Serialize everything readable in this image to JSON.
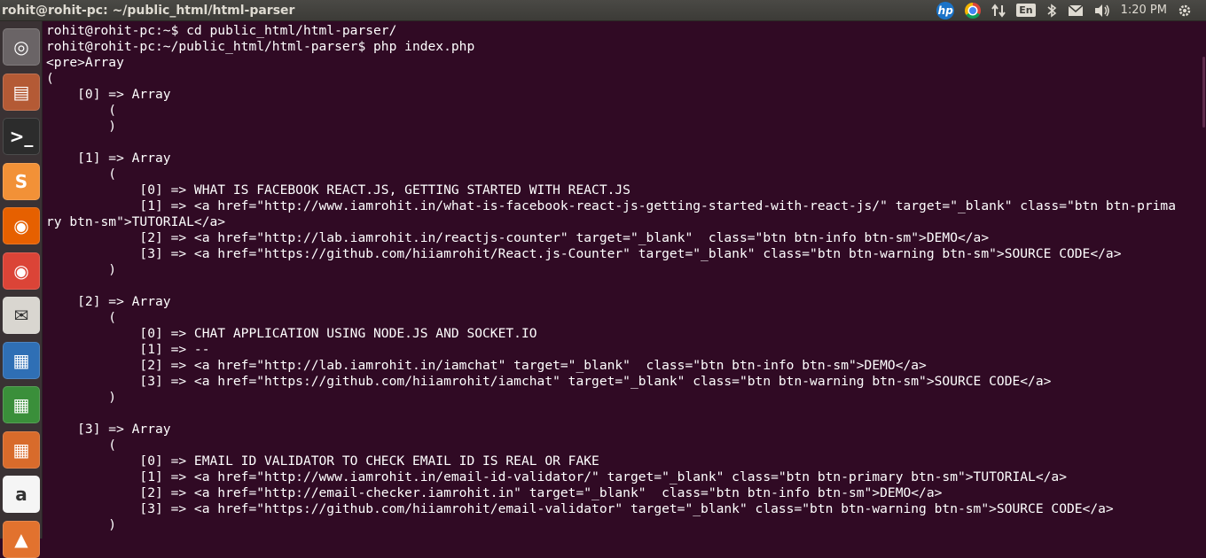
{
  "window": {
    "title": "rohit@rohit-pc: ~/public_html/html-parser"
  },
  "indicators": {
    "hp_label": "hp",
    "lang": "En",
    "clock": "1:20 PM",
    "icons": [
      "hp-icon",
      "chrome-icon",
      "network-arrows-icon",
      "keyboard-lang-icon",
      "bluetooth-icon",
      "mail-icon",
      "volume-icon"
    ]
  },
  "launcher": {
    "items": [
      {
        "name": "ubuntu-dash-icon",
        "glyph": "◎",
        "bg": "#6a6466"
      },
      {
        "name": "files-icon",
        "glyph": "▤",
        "bg": "#b45a35"
      },
      {
        "name": "terminal-icon",
        "glyph": ">_",
        "bg": "#2c2c2c"
      },
      {
        "name": "sublime-text-icon",
        "glyph": "S",
        "bg": "#f29137"
      },
      {
        "name": "firefox-icon",
        "glyph": "◉",
        "bg": "#e66000"
      },
      {
        "name": "chrome-icon",
        "glyph": "◉",
        "bg": "#db4437"
      },
      {
        "name": "mail-client-icon",
        "glyph": "✉",
        "bg": "#d9d6d0"
      },
      {
        "name": "writer-icon",
        "glyph": "▦",
        "bg": "#2f6fb5"
      },
      {
        "name": "calc-icon",
        "glyph": "▦",
        "bg": "#3a8f3a"
      },
      {
        "name": "impress-icon",
        "glyph": "▦",
        "bg": "#d86b2b"
      },
      {
        "name": "amazon-icon",
        "glyph": "a",
        "bg": "#f5f5f5"
      },
      {
        "name": "software-center-icon",
        "glyph": "▲",
        "bg": "#e2722e"
      }
    ]
  },
  "terminal": {
    "lines": [
      "rohit@rohit-pc:~$ cd public_html/html-parser/",
      "rohit@rohit-pc:~/public_html/html-parser$ php index.php",
      "<pre>Array",
      "(",
      "    [0] => Array",
      "        (",
      "        )",
      "",
      "    [1] => Array",
      "        (",
      "            [0] => WHAT IS FACEBOOK REACT.JS, GETTING STARTED WITH REACT.JS",
      "            [1] => <a href=\"http://www.iamrohit.in/what-is-facebook-react-js-getting-started-with-react-js/\" target=\"_blank\" class=\"btn btn-prima",
      "ry btn-sm\">TUTORIAL</a>",
      "            [2] => <a href=\"http://lab.iamrohit.in/reactjs-counter\" target=\"_blank\"  class=\"btn btn-info btn-sm\">DEMO</a>",
      "            [3] => <a href=\"https://github.com/hiiamrohit/React.js-Counter\" target=\"_blank\" class=\"btn btn-warning btn-sm\">SOURCE CODE</a>",
      "        )",
      "",
      "    [2] => Array",
      "        (",
      "            [0] => CHAT APPLICATION USING NODE.JS AND SOCKET.IO",
      "            [1] => --",
      "            [2] => <a href=\"http://lab.iamrohit.in/iamchat\" target=\"_blank\"  class=\"btn btn-info btn-sm\">DEMO</a>",
      "            [3] => <a href=\"https://github.com/hiiamrohit/iamchat\" target=\"_blank\" class=\"btn btn-warning btn-sm\">SOURCE CODE</a>",
      "        )",
      "",
      "    [3] => Array",
      "        (",
      "            [0] => EMAIL ID VALIDATOR TO CHECK EMAIL ID IS REAL OR FAKE",
      "            [1] => <a href=\"http://www.iamrohit.in/email-id-validator/\" target=\"_blank\" class=\"btn btn-primary btn-sm\">TUTORIAL</a>",
      "            [2] => <a href=\"http://email-checker.iamrohit.in\" target=\"_blank\"  class=\"btn btn-info btn-sm\">DEMO</a>",
      "            [3] => <a href=\"https://github.com/hiiamrohit/email-validator\" target=\"_blank\" class=\"btn btn-warning btn-sm\">SOURCE CODE</a>",
      "        )",
      ""
    ]
  },
  "colors": {
    "terminal_bg": "#300a24",
    "terminal_fg": "#ffffff",
    "panel_bg": "#3c3b37",
    "launcher_bg": "#3a3234"
  }
}
